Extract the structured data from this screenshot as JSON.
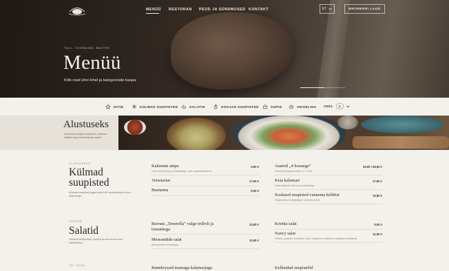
{
  "header": {
    "nav": [
      {
        "label": "MENÜÜ",
        "active": true
      },
      {
        "label": "RESTORAN",
        "active": false
      },
      {
        "label": "PEOD JA SÜNDMUSED",
        "active": false
      },
      {
        "label": "KONTAKT",
        "active": false
      }
    ],
    "lang": "ET",
    "book_label": "BRONEERI LAUD"
  },
  "hero": {
    "kicker": "TULI. TOORAINE. MAITSE.",
    "title": "Menüü",
    "subtitle": "Kõik road ühel lehel ja kategooriate kaupa."
  },
  "categories": [
    {
      "label": "HITID",
      "icon": "star-icon"
    },
    {
      "label": "KÜLMAD SUUPISTED",
      "icon": "snowflake-icon"
    },
    {
      "label": "SALATID",
      "icon": "salad-bowl-icon"
    },
    {
      "label": "SOOJAD SUUPISTED",
      "icon": "flame-icon"
    },
    {
      "label": "SUPID",
      "icon": "soup-pot-icon"
    },
    {
      "label": "VEISELIHA",
      "icon": "beef-icon"
    }
  ],
  "more": {
    "label": "VEEL",
    "count": "8"
  },
  "banner": {
    "title": "Alustuseks",
    "text": "Külmad ja soojad suupisted, värsked salatid ning rammestavad supid."
  },
  "sections": [
    {
      "kicker": "ALUSTUSEKS",
      "title": "Külmad suupisted",
      "desc": "Külmad suupisted jagamiseks või naudinmiseks ennu kasemaige."
    },
    {
      "kicker": "SERVEE",
      "title": "Salatid",
      "desc": "Värsked köögiviljad, juustud ja meresanni mee kastmetega."
    },
    {
      "kicker": "EEL SUUA",
      "title": ""
    }
  ],
  "menu_left": [
    {
      "name": "Kakumäe amps",
      "desc": "Leib suvepeeti ja kurudkraaga, värv maadkastmene",
      "price": "5,90 €"
    },
    {
      "name": "Veisetartar",
      "desc": "",
      "price": "17,50 €"
    },
    {
      "name": "Basturma",
      "desc": "",
      "price": "8,50 €"
    },
    {
      "name": "Burrata „Tenerella“ valge trühvli ja tomatitega",
      "desc": "",
      "price": "13,90 €"
    },
    {
      "name": "Mereandide salat",
      "desc": "Mereandid suvikaspiga",
      "price": "12,50 €"
    },
    {
      "name": "Rannkryssid mamaga kalamarjaga",
      "desc": "",
      "price": ""
    }
  ],
  "menu_right": [
    {
      "name": "Austrid „4 hooaega“",
      "desc": "Värskelt avatud austrid, 6 / 12 tk",
      "price": "26,90 / 48,90 €"
    },
    {
      "name": "Keta kalamari",
      "desc": "Keta kalamari võir ja kruutonidega",
      "price": "17,90 €"
    },
    {
      "name": "Soolased suupisted vanaema keldrist",
      "desc": "Hapendatud köögiviljad, seened ja leib",
      "price": "16,90 €"
    },
    {
      "name": "Kreeka salat",
      "desc": "",
      "price": "9,50 €"
    },
    {
      "name": "Nancy salat",
      "desc": "Poltiva, pastalo, kanafileo, kurk, tinginarvi, olivid ja mesjsinepi vinegrett",
      "price": "11,90 €"
    },
    {
      "name": "Kellendad suupistelid",
      "desc": "",
      "price": ""
    }
  ]
}
